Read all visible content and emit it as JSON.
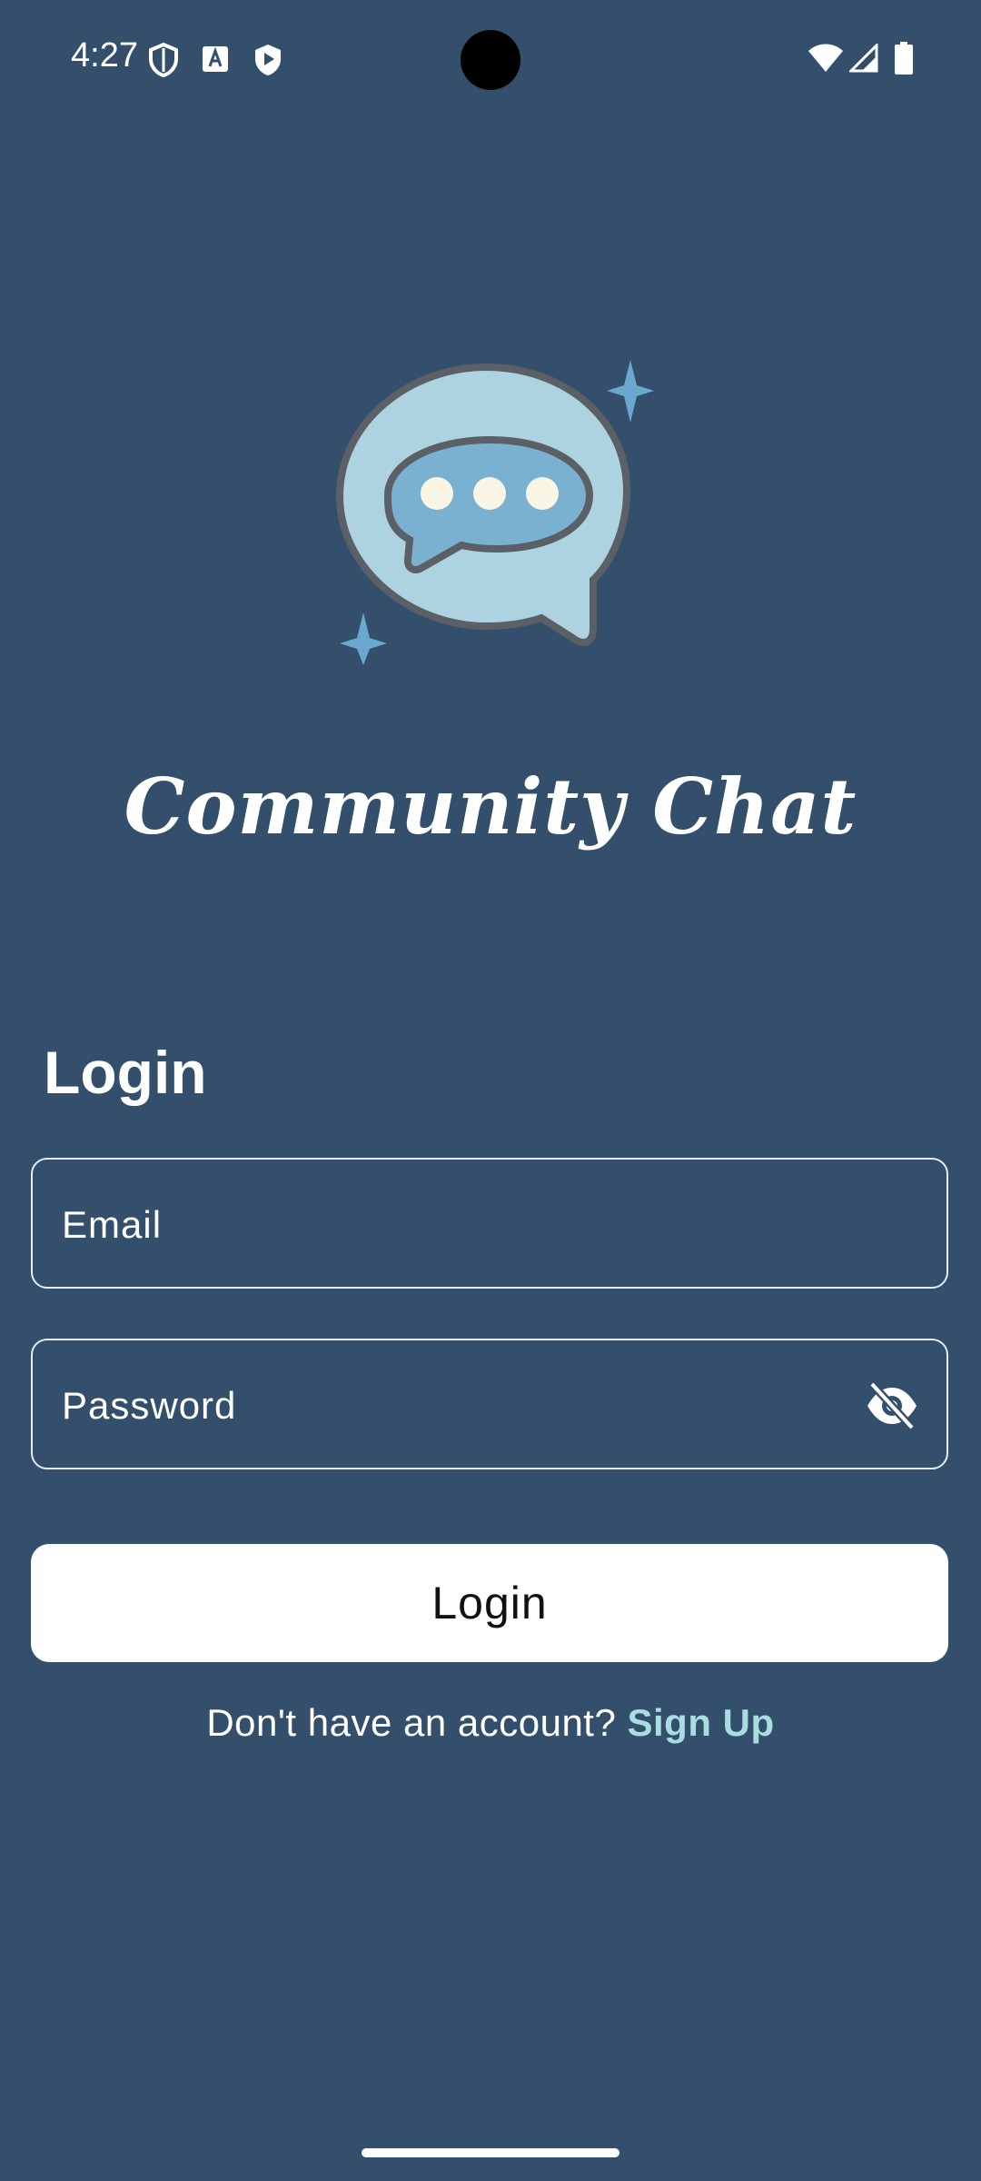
{
  "status_bar": {
    "time": "4:27",
    "icons": [
      "shield-outline-icon",
      "text-a-icon",
      "play-protect-icon",
      "wifi-icon",
      "signal-icon",
      "battery-icon"
    ]
  },
  "app": {
    "title": "Community Chat",
    "logo": "chat-bubble-logo"
  },
  "login_form": {
    "heading": "Login",
    "email_placeholder": "Email",
    "password_placeholder": "Password",
    "password_toggle_icon": "visibility-off-icon",
    "submit_label": "Login",
    "signup_prompt": "Don't have an account? ",
    "signup_link": "Sign Up"
  },
  "colors": {
    "background": "#334f6b",
    "accent_link": "#a9dde0",
    "logo_outer": "#aed3e0",
    "logo_inner": "#7ab0d0",
    "sparkle": "#6aa8d0"
  }
}
